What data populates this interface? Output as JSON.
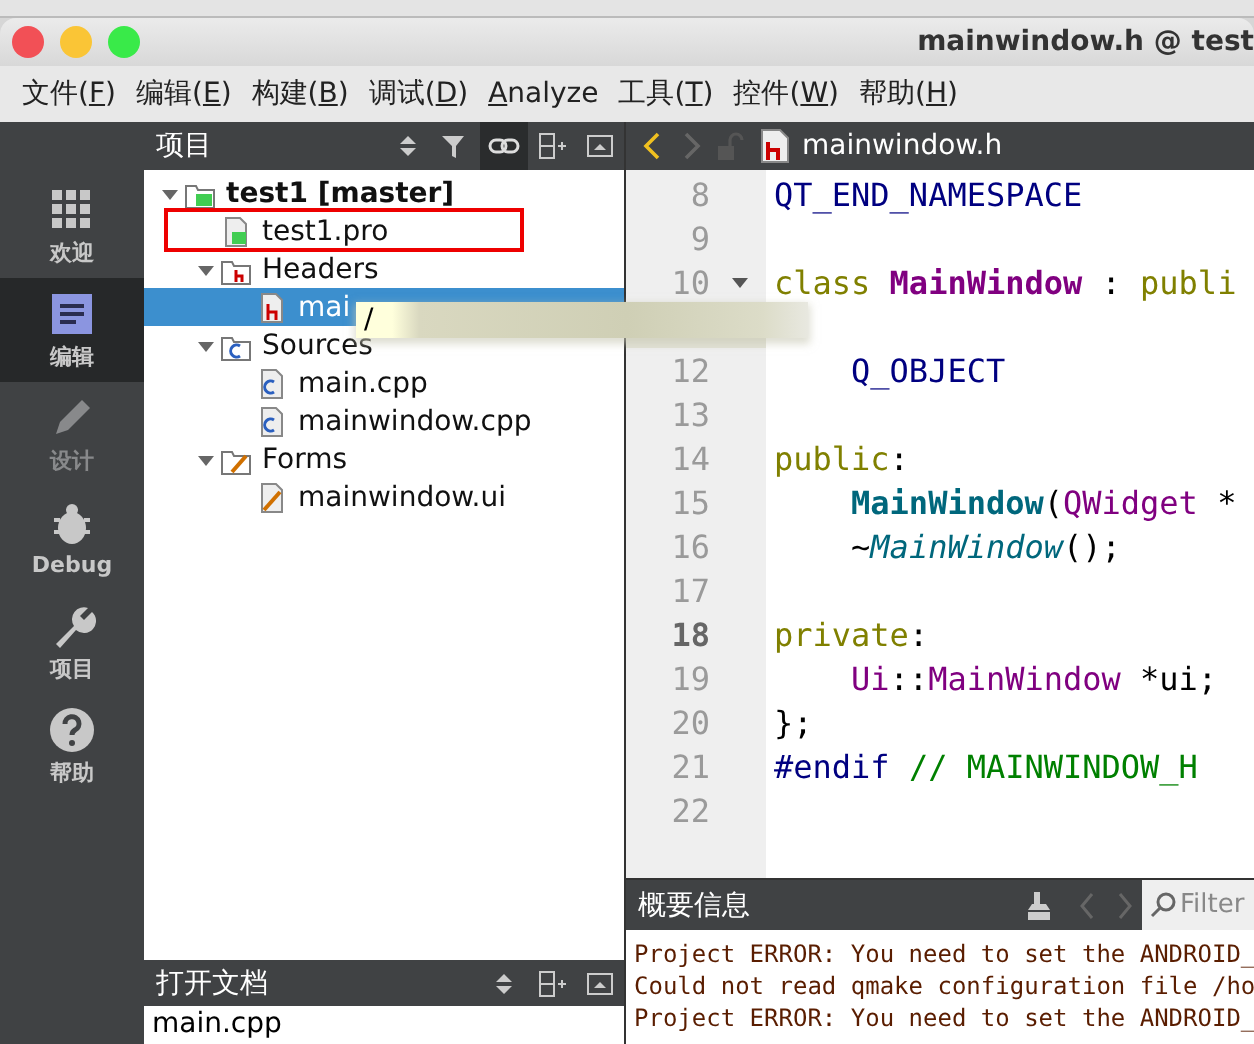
{
  "window": {
    "title": "mainwindow.h @ test"
  },
  "menu": [
    {
      "before": "文件(",
      "key": "F",
      "after": ")"
    },
    {
      "before": "编辑(",
      "key": "E",
      "after": ")"
    },
    {
      "before": "构建(",
      "key": "B",
      "after": ")"
    },
    {
      "before": "调试(",
      "key": "D",
      "after": ")"
    },
    {
      "key": "A",
      "after": "nalyze"
    },
    {
      "before": "工具(",
      "key": "T",
      "after": ")"
    },
    {
      "before": "控件(",
      "key": "W",
      "after": ")"
    },
    {
      "before": "帮助(",
      "key": "H",
      "after": ")"
    }
  ],
  "modes": [
    {
      "kind": "welcome",
      "label": "欢迎",
      "selected": false,
      "disabled": false
    },
    {
      "kind": "edit",
      "label": "编辑",
      "selected": true,
      "disabled": false
    },
    {
      "kind": "design",
      "label": "设计",
      "selected": false,
      "disabled": true
    },
    {
      "kind": "debug",
      "label": "Debug",
      "selected": false,
      "disabled": false
    },
    {
      "kind": "projects",
      "label": "项目",
      "selected": false,
      "disabled": false
    },
    {
      "kind": "help",
      "label": "帮助",
      "selected": false,
      "disabled": false
    }
  ],
  "project_panel": {
    "title": "项目",
    "tree": [
      {
        "label": "test1 [master]",
        "kind": "project",
        "bold": true,
        "expanded": true,
        "selected": false,
        "children": [
          {
            "label": "test1.pro",
            "kind": "pro",
            "highlighted": true,
            "selected": false
          },
          {
            "label": "Headers",
            "kind": "header-folder",
            "expanded": true,
            "selected": false,
            "children": [
              {
                "label": "mai",
                "kind": "header",
                "selected": true
              }
            ]
          },
          {
            "label": "Sources",
            "kind": "source-folder",
            "expanded": true,
            "selected": false,
            "children": [
              {
                "label": "main.cpp",
                "kind": "source",
                "selected": false
              },
              {
                "label": "mainwindow.cpp",
                "kind": "source",
                "selected": false
              }
            ]
          },
          {
            "label": "Forms",
            "kind": "form-folder",
            "expanded": true,
            "selected": false,
            "children": [
              {
                "label": "mainwindow.ui",
                "kind": "form",
                "selected": false
              }
            ]
          }
        ]
      }
    ]
  },
  "tooltip": {
    "text": "/"
  },
  "open_documents": {
    "title": "打开文档",
    "items": [
      "main.cpp"
    ]
  },
  "editor": {
    "file": "mainwindow.h",
    "lines": [
      {
        "number": "8",
        "tokens": [
          {
            "kind": "macro",
            "text": "QT_END_NAMESPACE"
          }
        ]
      },
      {
        "number": "9"
      },
      {
        "number": "10",
        "fold": true,
        "tokens": [
          {
            "kind": "keyword",
            "text": "class "
          },
          {
            "kind": "class",
            "text": "MainWindow"
          },
          {
            "kind": "plain",
            "text": " : "
          },
          {
            "kind": "keyword",
            "text": "publi"
          }
        ]
      },
      {
        "kind": "covered"
      },
      {
        "number": "12",
        "indented": true,
        "tokens": [
          {
            "kind": "macro",
            "text": "Q_OBJECT"
          }
        ]
      },
      {
        "number": "13"
      },
      {
        "number": "14",
        "tokens": [
          {
            "kind": "keyword",
            "text": "public"
          },
          {
            "kind": "plain",
            "text": ":"
          }
        ]
      },
      {
        "number": "15",
        "indented": true,
        "tokens": [
          {
            "kind": "function",
            "text": "MainWindow"
          },
          {
            "kind": "plain",
            "text": "("
          },
          {
            "kind": "type",
            "text": "QWidget"
          },
          {
            "kind": "plain",
            "text": " *"
          }
        ]
      },
      {
        "number": "16",
        "indented": true,
        "tokens": [
          {
            "kind": "plain",
            "text": "~"
          },
          {
            "kind": "virtual",
            "text": "MainWindow"
          },
          {
            "kind": "plain",
            "text": "();"
          }
        ]
      },
      {
        "number": "17"
      },
      {
        "number": "18",
        "current": true,
        "tokens": [
          {
            "kind": "keyword",
            "text": "private"
          },
          {
            "kind": "plain",
            "text": ":"
          }
        ]
      },
      {
        "number": "19",
        "indented": true,
        "tokens": [
          {
            "kind": "type",
            "text": "Ui"
          },
          {
            "kind": "plain",
            "text": "::"
          },
          {
            "kind": "type",
            "text": "MainWindow"
          },
          {
            "kind": "plain",
            "text": " *ui;"
          }
        ]
      },
      {
        "number": "20",
        "tokens": [
          {
            "kind": "plain",
            "text": "};"
          }
        ]
      },
      {
        "number": "21",
        "tokens": [
          {
            "kind": "macro",
            "text": "#endif "
          },
          {
            "kind": "comment",
            "text": "// MAINWINDOW_H"
          }
        ]
      },
      {
        "number": "22"
      }
    ]
  },
  "output": {
    "title": "概要信息",
    "filter": {
      "placeholder": "Filter"
    },
    "lines": [
      "Project ERROR: You need to set the ANDROID_",
      "Could not read qmake configuration file /ho",
      "Project ERROR: You need to set the ANDROID_"
    ]
  }
}
